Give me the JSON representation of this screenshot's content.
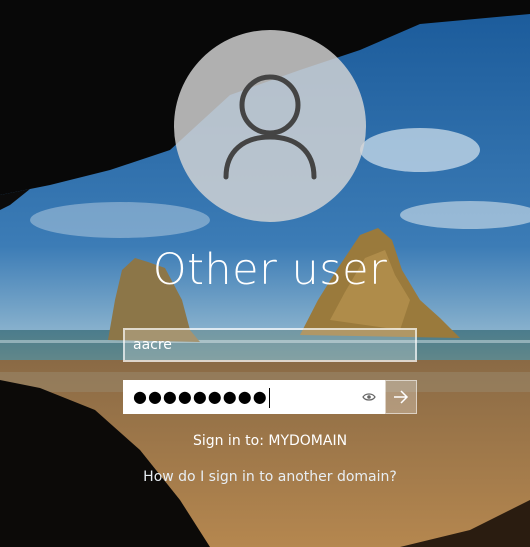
{
  "user": {
    "display_name": "Other user",
    "avatar_icon": "user-silhouette-icon"
  },
  "login": {
    "username_value": "aacre",
    "password_masked": "●●●●●●●●●",
    "reveal_icon": "eye-icon",
    "submit_icon": "arrow-right-icon"
  },
  "domain": {
    "sign_in_to": "Sign in to: MYDOMAIN",
    "help_link": "How do I sign in to another domain?"
  }
}
